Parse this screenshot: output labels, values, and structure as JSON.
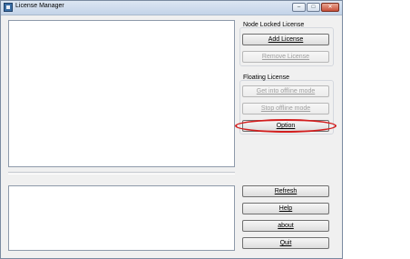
{
  "window": {
    "title": "License Manager",
    "controls": {
      "minimize": "–",
      "maximize": "□",
      "close": "✕"
    }
  },
  "node_locked": {
    "group_label": "Node Locked License",
    "add_label": "Add License",
    "remove_label": "Remove License"
  },
  "floating": {
    "group_label": "Floating License",
    "offline_label": "Get into offline mode",
    "stop_offline_label": "Stop offline mode",
    "option_label": "Option"
  },
  "actions": {
    "refresh_label": "Refresh",
    "help_label": "Help",
    "about_label": "about",
    "quit_label": "Quit"
  },
  "colors": {
    "highlight": "#d21e1e",
    "titlebar": "#c3d3e8",
    "window_bg": "#f0f0f0"
  }
}
